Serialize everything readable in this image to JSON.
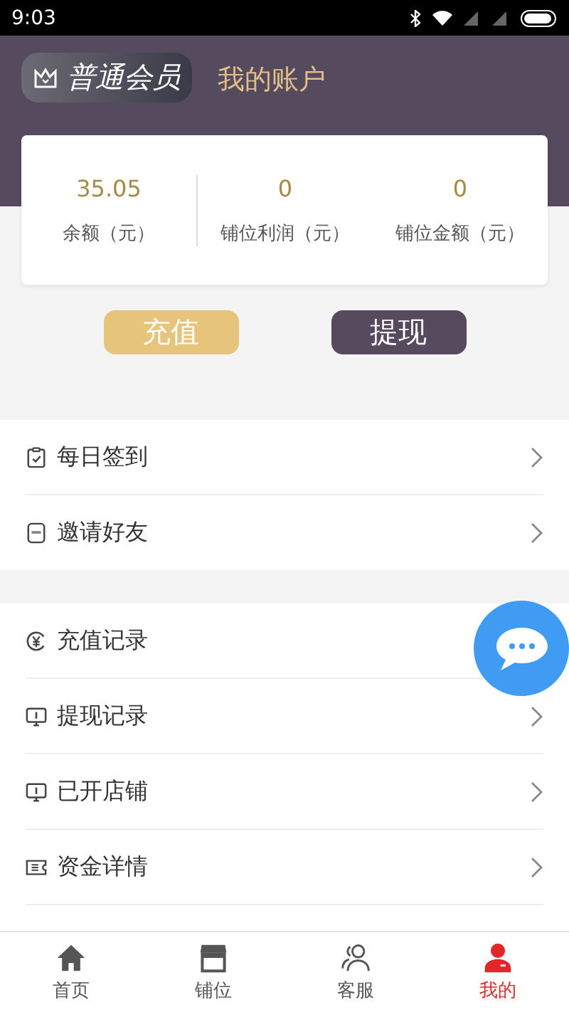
{
  "status_bar": {
    "time": "9:03"
  },
  "header": {
    "member_badge": "普通会员",
    "title": "我的账户"
  },
  "stats": [
    {
      "value": "35.05",
      "label": "余额（元）"
    },
    {
      "value": "0",
      "label": "铺位利润（元）"
    },
    {
      "value": "0",
      "label": "铺位金额（元）"
    }
  ],
  "actions": [
    {
      "label": "充值",
      "kind": "primary"
    },
    {
      "label": "提现",
      "kind": "secondary"
    }
  ],
  "menu_sections": [
    {
      "items": [
        {
          "label": "每日签到",
          "kind": "clipboard",
          "chevron": true
        },
        {
          "label": "邀请好友",
          "kind": "new",
          "chevron": true
        }
      ]
    },
    {
      "items": [
        {
          "label": "充值记录",
          "kind": "yen",
          "chevron": false
        },
        {
          "label": "提现记录",
          "kind": "monitor",
          "chevron": true
        },
        {
          "label": "已开店铺",
          "kind": "monitor",
          "chevron": true
        },
        {
          "label": "资金详情",
          "kind": "card",
          "chevron": true
        }
      ]
    }
  ],
  "bottom_nav": [
    {
      "label": "首页",
      "kind": "home",
      "selected": false
    },
    {
      "label": "铺位",
      "kind": "shop",
      "selected": false
    },
    {
      "label": "客服",
      "kind": "people",
      "selected": false
    },
    {
      "label": "我的",
      "kind": "user",
      "selected": true
    }
  ]
}
